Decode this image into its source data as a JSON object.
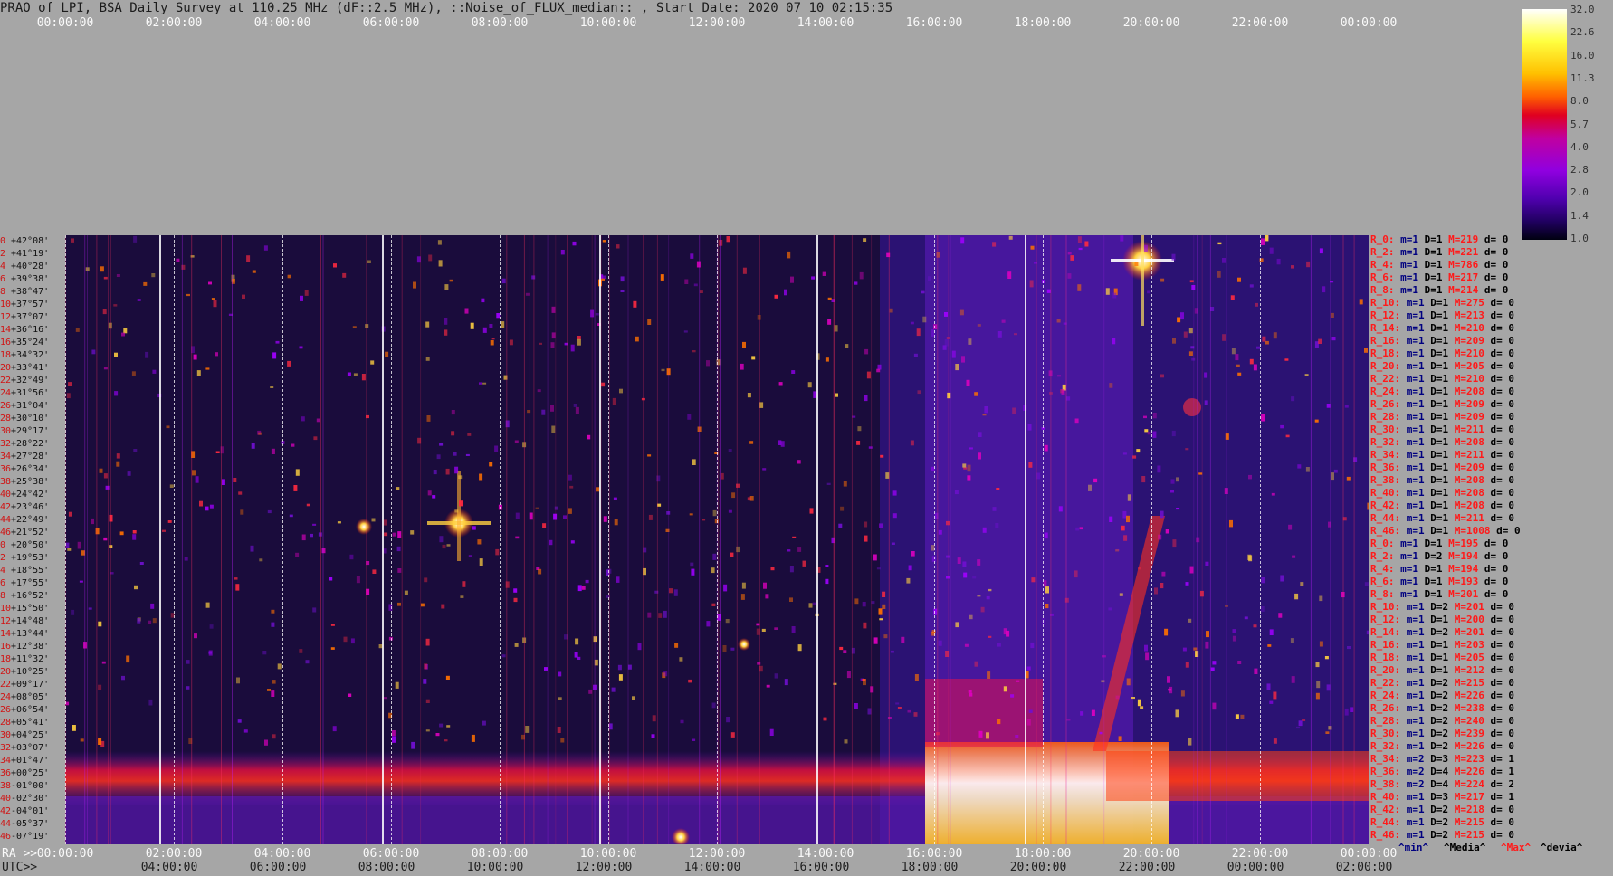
{
  "title": "PRAO of LPI, BSA Daily Survey at 110.25 MHz (dF::2.5 MHz), ::Noise_of_FLUX_median:: , Start Date: 2020 07 10 02:15:35",
  "top_time_ticks": [
    "00:00:00",
    "02:00:00",
    "04:00:00",
    "06:00:00",
    "08:00:00",
    "10:00:00",
    "12:00:00",
    "14:00:00",
    "16:00:00",
    "18:00:00",
    "20:00:00",
    "22:00:00",
    "00:00:00"
  ],
  "ra_label": "RA >>",
  "utc_label": "UTC>>",
  "ra_ticks": [
    "00:00:00",
    "02:00:00",
    "04:00:00",
    "06:00:00",
    "08:00:00",
    "10:00:00",
    "12:00:00",
    "14:00:00",
    "16:00:00",
    "18:00:00",
    "20:00:00",
    "22:00:00",
    "00:00:00"
  ],
  "utc_ticks": [
    "04:00:00",
    "06:00:00",
    "08:00:00",
    "10:00:00",
    "12:00:00",
    "14:00:00",
    "16:00:00",
    "18:00:00",
    "20:00:00",
    "22:00:00",
    "00:00:00",
    "02:00:00"
  ],
  "colorbar": {
    "labels": [
      "32.0",
      "22.6",
      "16.0",
      "11.3",
      "8.0",
      "5.7",
      "4.0",
      "2.8",
      "2.0",
      "1.4",
      "1.0"
    ]
  },
  "declinations": [
    {
      "idx": "0",
      "dec": "+42°08'"
    },
    {
      "idx": "2",
      "dec": "+41°19'"
    },
    {
      "idx": "4",
      "dec": "+40°28'"
    },
    {
      "idx": "6",
      "dec": "+39°38'"
    },
    {
      "idx": "8",
      "dec": "+38°47'"
    },
    {
      "idx": "10",
      "dec": "+37°57'"
    },
    {
      "idx": "12",
      "dec": "+37°07'"
    },
    {
      "idx": "14",
      "dec": "+36°16'"
    },
    {
      "idx": "16",
      "dec": "+35°24'"
    },
    {
      "idx": "18",
      "dec": "+34°32'"
    },
    {
      "idx": "20",
      "dec": "+33°41'"
    },
    {
      "idx": "22",
      "dec": "+32°49'"
    },
    {
      "idx": "24",
      "dec": "+31°56'"
    },
    {
      "idx": "26",
      "dec": "+31°04'"
    },
    {
      "idx": "28",
      "dec": "+30°10'"
    },
    {
      "idx": "30",
      "dec": "+29°17'"
    },
    {
      "idx": "32",
      "dec": "+28°22'"
    },
    {
      "idx": "34",
      "dec": "+27°28'"
    },
    {
      "idx": "36",
      "dec": "+26°34'"
    },
    {
      "idx": "38",
      "dec": "+25°38'"
    },
    {
      "idx": "40",
      "dec": "+24°42'"
    },
    {
      "idx": "42",
      "dec": "+23°46'"
    },
    {
      "idx": "44",
      "dec": "+22°49'"
    },
    {
      "idx": "46",
      "dec": "+21°52'"
    },
    {
      "idx": "0",
      "dec": "+20°50'"
    },
    {
      "idx": "2",
      "dec": "+19°53'"
    },
    {
      "idx": "4",
      "dec": "+18°55'"
    },
    {
      "idx": "6",
      "dec": "+17°55'"
    },
    {
      "idx": "8",
      "dec": "+16°52'"
    },
    {
      "idx": "10",
      "dec": "+15°50'"
    },
    {
      "idx": "12",
      "dec": "+14°48'"
    },
    {
      "idx": "14",
      "dec": "+13°44'"
    },
    {
      "idx": "16",
      "dec": "+12°38'"
    },
    {
      "idx": "18",
      "dec": "+11°32'"
    },
    {
      "idx": "20",
      "dec": "+10°25'"
    },
    {
      "idx": "22",
      "dec": "+09°17'"
    },
    {
      "idx": "24",
      "dec": "+08°05'"
    },
    {
      "idx": "26",
      "dec": "+06°54'"
    },
    {
      "idx": "28",
      "dec": "+05°41'"
    },
    {
      "idx": "30",
      "dec": "+04°25'"
    },
    {
      "idx": "32",
      "dec": "+03°07'"
    },
    {
      "idx": "34",
      "dec": "+01°47'"
    },
    {
      "idx": "36",
      "dec": "+00°25'"
    },
    {
      "idx": "38",
      "dec": "-01°00'"
    },
    {
      "idx": "40",
      "dec": "-02°30'"
    },
    {
      "idx": "42",
      "dec": "-04°01'"
    },
    {
      "idx": "44",
      "dec": "-05°37'"
    },
    {
      "idx": "46",
      "dec": "-07°19'"
    }
  ],
  "stats_rows": [
    {
      "name": "R_0:",
      "min": "m=1",
      "med": "D=1",
      "max": "M=219",
      "dev": "d= 0"
    },
    {
      "name": "R_2:",
      "min": "m=1",
      "med": "D=1",
      "max": "M=221",
      "dev": "d= 0"
    },
    {
      "name": "R_4:",
      "min": "m=1",
      "med": "D=1",
      "max": "M=786",
      "dev": "d= 0"
    },
    {
      "name": "R_6:",
      "min": "m=1",
      "med": "D=1",
      "max": "M=217",
      "dev": "d= 0"
    },
    {
      "name": "R_8:",
      "min": "m=1",
      "med": "D=1",
      "max": "M=214",
      "dev": "d= 0"
    },
    {
      "name": "R_10:",
      "min": "m=1",
      "med": "D=1",
      "max": "M=275",
      "dev": "d= 0"
    },
    {
      "name": "R_12:",
      "min": "m=1",
      "med": "D=1",
      "max": "M=213",
      "dev": "d= 0"
    },
    {
      "name": "R_14:",
      "min": "m=1",
      "med": "D=1",
      "max": "M=210",
      "dev": "d= 0"
    },
    {
      "name": "R_16:",
      "min": "m=1",
      "med": "D=1",
      "max": "M=209",
      "dev": "d= 0"
    },
    {
      "name": "R_18:",
      "min": "m=1",
      "med": "D=1",
      "max": "M=210",
      "dev": "d= 0"
    },
    {
      "name": "R_20:",
      "min": "m=1",
      "med": "D=1",
      "max": "M=205",
      "dev": "d= 0"
    },
    {
      "name": "R_22:",
      "min": "m=1",
      "med": "D=1",
      "max": "M=210",
      "dev": "d= 0"
    },
    {
      "name": "R_24:",
      "min": "m=1",
      "med": "D=1",
      "max": "M=208",
      "dev": "d= 0"
    },
    {
      "name": "R_26:",
      "min": "m=1",
      "med": "D=1",
      "max": "M=209",
      "dev": "d= 0"
    },
    {
      "name": "R_28:",
      "min": "m=1",
      "med": "D=1",
      "max": "M=209",
      "dev": "d= 0"
    },
    {
      "name": "R_30:",
      "min": "m=1",
      "med": "D=1",
      "max": "M=211",
      "dev": "d= 0"
    },
    {
      "name": "R_32:",
      "min": "m=1",
      "med": "D=1",
      "max": "M=208",
      "dev": "d= 0"
    },
    {
      "name": "R_34:",
      "min": "m=1",
      "med": "D=1",
      "max": "M=211",
      "dev": "d= 0"
    },
    {
      "name": "R_36:",
      "min": "m=1",
      "med": "D=1",
      "max": "M=209",
      "dev": "d= 0"
    },
    {
      "name": "R_38:",
      "min": "m=1",
      "med": "D=1",
      "max": "M=208",
      "dev": "d= 0"
    },
    {
      "name": "R_40:",
      "min": "m=1",
      "med": "D=1",
      "max": "M=208",
      "dev": "d= 0"
    },
    {
      "name": "R_42:",
      "min": "m=1",
      "med": "D=1",
      "max": "M=208",
      "dev": "d= 0"
    },
    {
      "name": "R_44:",
      "min": "m=1",
      "med": "D=1",
      "max": "M=211",
      "dev": "d= 0"
    },
    {
      "name": "R_46:",
      "min": "m=1",
      "med": "D=1",
      "max": "M=1008",
      "dev": "d= 0"
    },
    {
      "name": "R_0:",
      "min": "m=1",
      "med": "D=1",
      "max": "M=195",
      "dev": "d= 0"
    },
    {
      "name": "R_2:",
      "min": "m=1",
      "med": "D=2",
      "max": "M=194",
      "dev": "d= 0"
    },
    {
      "name": "R_4:",
      "min": "m=1",
      "med": "D=1",
      "max": "M=194",
      "dev": "d= 0"
    },
    {
      "name": "R_6:",
      "min": "m=1",
      "med": "D=1",
      "max": "M=193",
      "dev": "d= 0"
    },
    {
      "name": "R_8:",
      "min": "m=1",
      "med": "D=1",
      "max": "M=201",
      "dev": "d= 0"
    },
    {
      "name": "R_10:",
      "min": "m=1",
      "med": "D=2",
      "max": "M=201",
      "dev": "d= 0"
    },
    {
      "name": "R_12:",
      "min": "m=1",
      "med": "D=1",
      "max": "M=200",
      "dev": "d= 0"
    },
    {
      "name": "R_14:",
      "min": "m=1",
      "med": "D=2",
      "max": "M=201",
      "dev": "d= 0"
    },
    {
      "name": "R_16:",
      "min": "m=1",
      "med": "D=1",
      "max": "M=203",
      "dev": "d= 0"
    },
    {
      "name": "R_18:",
      "min": "m=1",
      "med": "D=1",
      "max": "M=205",
      "dev": "d= 0"
    },
    {
      "name": "R_20:",
      "min": "m=1",
      "med": "D=1",
      "max": "M=212",
      "dev": "d= 0"
    },
    {
      "name": "R_22:",
      "min": "m=1",
      "med": "D=2",
      "max": "M=215",
      "dev": "d= 0"
    },
    {
      "name": "R_24:",
      "min": "m=1",
      "med": "D=2",
      "max": "M=226",
      "dev": "d= 0"
    },
    {
      "name": "R_26:",
      "min": "m=1",
      "med": "D=2",
      "max": "M=238",
      "dev": "d= 0"
    },
    {
      "name": "R_28:",
      "min": "m=1",
      "med": "D=2",
      "max": "M=240",
      "dev": "d= 0"
    },
    {
      "name": "R_30:",
      "min": "m=1",
      "med": "D=2",
      "max": "M=239",
      "dev": "d= 0"
    },
    {
      "name": "R_32:",
      "min": "m=1",
      "med": "D=2",
      "max": "M=226",
      "dev": "d= 0"
    },
    {
      "name": "R_34:",
      "min": "m=2",
      "med": "D=3",
      "max": "M=223",
      "dev": "d= 1"
    },
    {
      "name": "R_36:",
      "min": "m=2",
      "med": "D=4",
      "max": "M=226",
      "dev": "d= 1"
    },
    {
      "name": "R_38:",
      "min": "m=2",
      "med": "D=4",
      "max": "M=224",
      "dev": "d= 2"
    },
    {
      "name": "R_40:",
      "min": "m=1",
      "med": "D=3",
      "max": "M=217",
      "dev": "d= 1"
    },
    {
      "name": "R_42:",
      "min": "m=1",
      "med": "D=2",
      "max": "M=218",
      "dev": "d= 0"
    },
    {
      "name": "R_44:",
      "min": "m=1",
      "med": "D=2",
      "max": "M=215",
      "dev": "d= 0"
    },
    {
      "name": "R_46:",
      "min": "m=1",
      "med": "D=2",
      "max": "M=215",
      "dev": "d= 0"
    }
  ],
  "legend": {
    "min": "^min^",
    "median": "^Media^",
    "max": "^Max^",
    "dev": "^devia^"
  },
  "colors": {
    "background": "#a6a6a6",
    "plot_bg": "#140a2e",
    "max_red": "#ff1a1a",
    "min_blue": "#000080"
  }
}
